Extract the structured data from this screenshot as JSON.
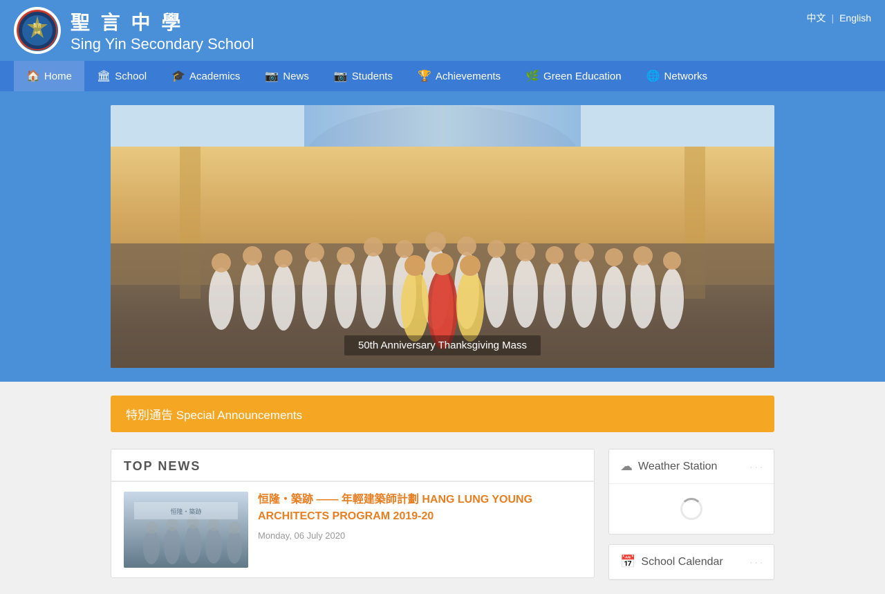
{
  "lang": {
    "chinese": "中文",
    "english": "English"
  },
  "header": {
    "school_chinese": "聖 言 中 學",
    "school_english": "Sing Yin Secondary School"
  },
  "nav": {
    "items": [
      {
        "label": "Home",
        "icon": "🏠",
        "active": true
      },
      {
        "label": "School",
        "icon": "🏛"
      },
      {
        "label": "Academics",
        "icon": "🎓"
      },
      {
        "label": "News",
        "icon": "📷"
      },
      {
        "label": "Students",
        "icon": "📷"
      },
      {
        "label": "Achievements",
        "icon": "🏆"
      },
      {
        "label": "Green Education",
        "icon": "🌿"
      },
      {
        "label": "Networks",
        "icon": "🌐"
      }
    ]
  },
  "hero": {
    "caption": "50th Anniversary Thanksgiving Mass"
  },
  "announcement": {
    "label": "特別通告 Special Announcements"
  },
  "top_news": {
    "heading": "TOP NEWS",
    "items": [
      {
        "title": "恒隆‧築跡 ——  年輕建築師計劃 HANG LUNG YOUNG ARCHITECTS PROGRAM 2019-20",
        "date": "Monday, 06 July 2020"
      }
    ]
  },
  "sidebar": {
    "weather_widget": {
      "title": "Weather Station",
      "icon": "☁"
    },
    "calendar_widget": {
      "title": "School Calendar",
      "icon": "📅"
    }
  }
}
